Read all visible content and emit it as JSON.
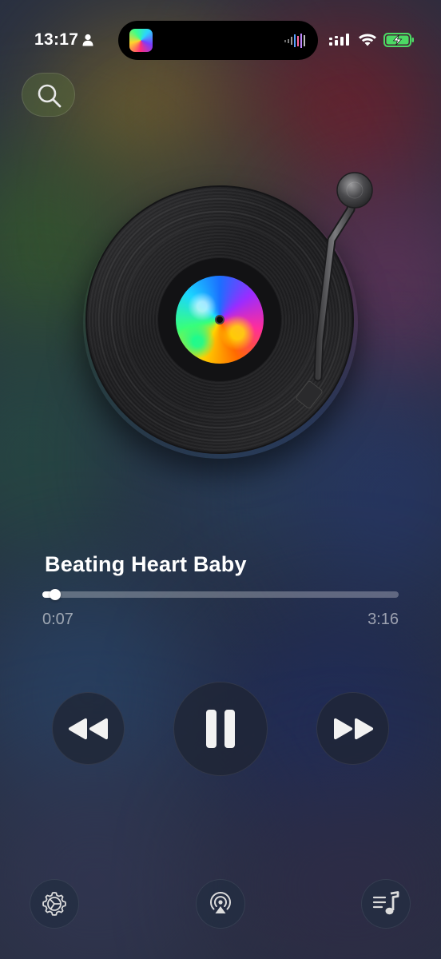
{
  "status_bar": {
    "time": "13:17",
    "battery_charging": true
  },
  "search": {
    "icon": "search-icon"
  },
  "now_playing": {
    "title": "Beating Heart Baby",
    "elapsed": "0:07",
    "duration": "3:16",
    "progress_fraction": 0.036
  },
  "controls": {
    "rewind_icon": "rewind-icon",
    "play_pause_icon": "pause-icon",
    "forward_icon": "fast-forward-icon"
  },
  "bottom_bar": {
    "settings_icon": "settings-gear-icon",
    "airplay_icon": "airplay-icon",
    "playlist_icon": "playlist-music-icon"
  },
  "colors": {
    "accent": "#ffffff",
    "battery_green": "#4cd964"
  }
}
